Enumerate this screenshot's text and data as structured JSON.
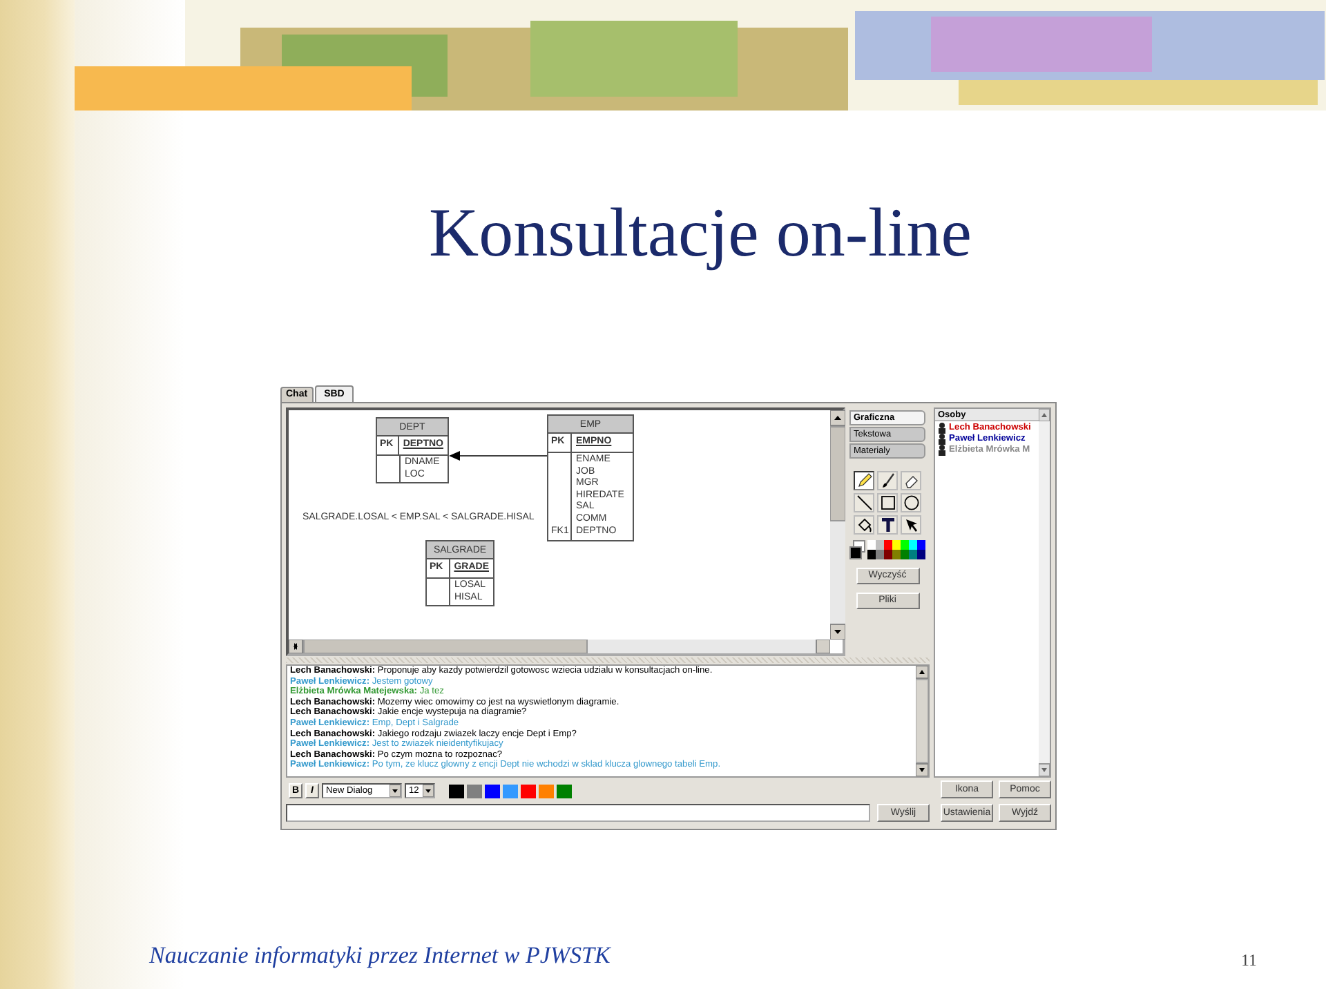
{
  "slide": {
    "title": "Konsultacje on-line",
    "footer": "Nauczanie informatyki przez Internet w PJWSTK",
    "page_number": "11"
  },
  "app": {
    "tabs": [
      {
        "label": "Chat",
        "selected": false
      },
      {
        "label": "SBD",
        "selected": true
      }
    ],
    "diagram": {
      "entities": [
        {
          "name": "DEPT",
          "rows": [
            {
              "kind": "primary",
              "key": "PK",
              "columns": [
                "DEPTNO"
              ]
            },
            {
              "kind": "attributes",
              "columns": [
                "DNAME",
                "LOC"
              ]
            }
          ]
        },
        {
          "name": "EMP",
          "rows": [
            {
              "kind": "primary",
              "key": "PK",
              "columns": [
                "EMPNO"
              ]
            },
            {
              "kind": "attributes",
              "columns": [
                "ENAME",
                "JOB",
                "MGR",
                "HIREDATE",
                "SAL",
                "COMM"
              ]
            },
            {
              "kind": "attributes",
              "key": "FK1",
              "columns": [
                "DEPTNO"
              ]
            }
          ]
        },
        {
          "name": "SALGRADE",
          "rows": [
            {
              "kind": "primary",
              "key": "PK",
              "columns": [
                "GRADE"
              ]
            },
            {
              "kind": "attributes",
              "columns": [
                "LOSAL",
                "HISAL"
              ]
            }
          ]
        }
      ],
      "constraint": "SALGRADE.LOSAL < EMP.SAL < SALGRADE.HISAL"
    },
    "tool_tabs": [
      {
        "label": "Graficzna",
        "selected": true
      },
      {
        "label": "Tekstowa",
        "selected": false
      },
      {
        "label": "Materialy",
        "selected": false
      }
    ],
    "tools": [
      {
        "kind": "pencil",
        "selected": true
      },
      {
        "kind": "brush",
        "selected": false
      },
      {
        "kind": "eraser",
        "selected": false
      },
      {
        "kind": "line",
        "selected": false
      },
      {
        "kind": "rectangle",
        "selected": false
      },
      {
        "kind": "ellipse",
        "selected": false
      },
      {
        "kind": "fill",
        "selected": false
      },
      {
        "kind": "text",
        "selected": false
      },
      {
        "kind": "pointer",
        "selected": false
      }
    ],
    "palette": [
      {
        "color": "#ffffff"
      },
      {
        "color": "#c0c0c0"
      },
      {
        "color": "#ff0000"
      },
      {
        "color": "#ffff00"
      },
      {
        "color": "#00ff00"
      },
      {
        "color": "#00ffff"
      },
      {
        "color": "#0000ff"
      },
      {
        "color": "#000000"
      },
      {
        "color": "#808080"
      },
      {
        "color": "#800000"
      },
      {
        "color": "#808000"
      },
      {
        "color": "#008000"
      },
      {
        "color": "#008080"
      },
      {
        "color": "#000080"
      }
    ],
    "tool_buttons": [
      "Wyczyść",
      "Pliki"
    ],
    "people": {
      "header": "Osoby",
      "items": [
        {
          "name": "Lech Banachowski",
          "color": "#cc0000"
        },
        {
          "name": "Paweł Lenkiewicz",
          "color": "#000099"
        },
        {
          "name": "Elżbieta Mrówka M",
          "color": "#888888"
        }
      ]
    },
    "messages": [
      {
        "author": "Lech Banachowski:",
        "text": "Proponuje aby kazdy potwierdzil gotowosc wziecia udzialu w konsultacjach on-line.",
        "color": "#000000"
      },
      {
        "author": "Paweł Lenkiewicz:",
        "text": "Jestem gotowy",
        "color": "#3399cc"
      },
      {
        "author": "Elżbieta Mrówka Matejewska:",
        "text": "Ja tez",
        "color": "#339933"
      },
      {
        "author": "Lech Banachowski:",
        "text": "Mozemy wiec omowimy co jest na wyswietlonym diagramie.",
        "color": "#000000"
      },
      {
        "author": "Lech Banachowski:",
        "text": "Jakie encje wystepuja na diagramie?",
        "color": "#000000"
      },
      {
        "author": "Paweł Lenkiewicz:",
        "text": "Emp, Dept i Salgrade",
        "color": "#3399cc"
      },
      {
        "author": "Lech Banachowski:",
        "text": "Jakiego rodzaju zwiazek laczy encje Dept i Emp?",
        "color": "#000000"
      },
      {
        "author": "Paweł Lenkiewicz:",
        "text": "Jest to zwiazek nieidentyfikujacy",
        "color": "#3399cc"
      },
      {
        "author": "Lech Banachowski:",
        "text": "Po czym mozna to rozpoznac?",
        "color": "#000000"
      },
      {
        "author": "Paweł Lenkiewicz:",
        "text": "Po tym, ze klucz glowny z encji Dept nie wchodzi w sklad klucza glownego tabeli Emp.",
        "color": "#3399cc"
      }
    ],
    "format_bar": {
      "bold": "B",
      "italic": "I",
      "font": "New Dialog",
      "size": "12",
      "colors": [
        {
          "color": "#000000"
        },
        {
          "color": "#808080"
        },
        {
          "color": "#0000ff"
        },
        {
          "color": "#3399ff"
        },
        {
          "color": "#ff0000"
        },
        {
          "color": "#ff8000"
        },
        {
          "color": "#008000"
        }
      ]
    },
    "send_button": "Wyślij",
    "side_buttons": [
      "Ikona",
      "Pomoc",
      "Ustawienia",
      "Wyjdź"
    ]
  }
}
